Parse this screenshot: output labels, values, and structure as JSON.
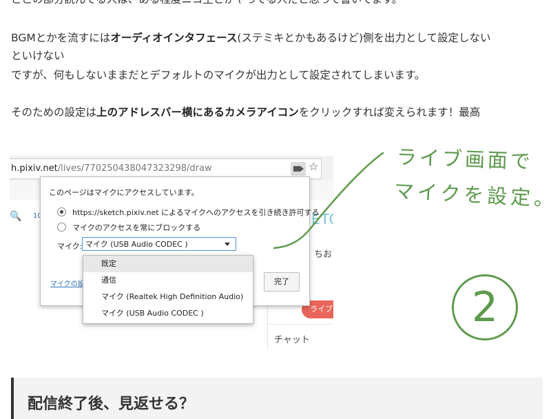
{
  "article": {
    "line0": "ここの部分読んでる人は、ある程度ニコ生とかやってる人だと思って書いてます。",
    "p1_before": "BGMとかを流すには",
    "p1_bold": "オーディオインタフェース",
    "p1_after": "(ステミキとかもあるけど)側を出力として設定しない",
    "p1_line2": "といけない",
    "p1_line3": "ですが、何もしないままだとデフォルトのマイクが出力として設定されてしまいます。",
    "p2_before": "そのための設定は",
    "p2_bold": "上のアドレスバー横にあるカメラアイコン",
    "p2_after": "をクリックすれば変えられます！最高",
    "heading": "配信終了後、見返せる？"
  },
  "screenshot": {
    "url_host": "h.pixiv.net",
    "url_path": "/lives/770250438047323298/draw",
    "bg_magnifier": "🔍",
    "bg_10": "10",
    "bg_eto": "ETC",
    "bg_chio": "ちお",
    "bg_live": "ライブ",
    "bg_chat": "チャット",
    "popup": {
      "title": "このページはマイクにアクセスしています。",
      "option_allow": "https://sketch.pixiv.net によるマイクへのアクセスを引き続き許可する",
      "option_block": "マイクのアクセスを常にブロックする",
      "mic_label": "マイク:",
      "mic_selected": "マイク (USB Audio CODEC )",
      "manage_link": "マイクの設",
      "done_button": "完了"
    },
    "dropdown_options": [
      "既定",
      "通信",
      "マイク (Realtek High Definition Audio)",
      "マイク (USB Audio CODEC )"
    ]
  },
  "handwriting": {
    "line1": "ライブ画面で",
    "line2": "マイクを設定。",
    "step_number": "2"
  },
  "colors": {
    "handwriting": "#5e9a4e",
    "link": "#2f73b8",
    "text": "#333333"
  }
}
